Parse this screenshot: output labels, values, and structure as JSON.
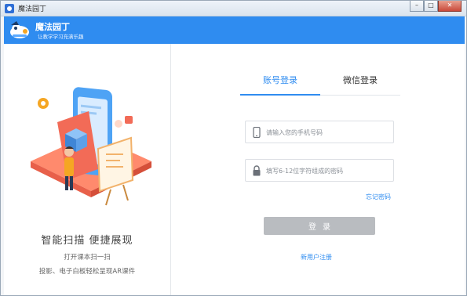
{
  "window": {
    "title": "魔法园丁",
    "min_label": "–",
    "max_label": "□",
    "close_label": "✕"
  },
  "header": {
    "app_name": "魔法园丁",
    "slogan": "让教学学习充满乐趣",
    "background": "#2f8cf0"
  },
  "promo": {
    "title": "智能扫描  便捷展现",
    "line1": "打开课本扫一扫",
    "line2": "投影、电子白板轻松呈现AR课件"
  },
  "login": {
    "tabs": [
      {
        "label": "账号登录",
        "active": true
      },
      {
        "label": "微信登录",
        "active": false
      }
    ],
    "phone_placeholder": "请输入您的手机号码",
    "password_placeholder": "填写6-12位字符组成的密码",
    "forgot_label": "忘记密码",
    "submit_label": "登录",
    "register_label": "新用户注册",
    "accent_color": "#2f8cf0",
    "button_color": "#b9bcc0"
  },
  "icons": {
    "phone": "phone-icon",
    "lock": "lock-icon"
  }
}
